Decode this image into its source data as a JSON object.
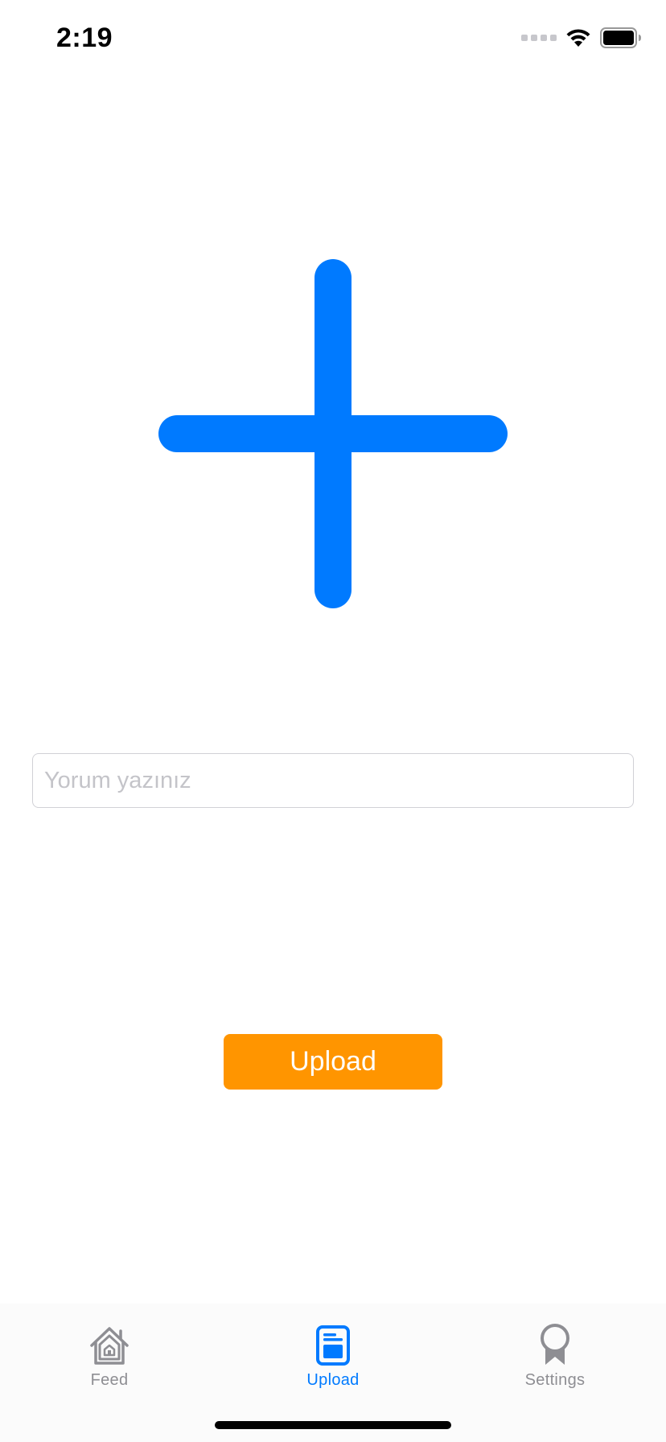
{
  "status_bar": {
    "time": "2:19"
  },
  "main": {
    "image_icon": "plus-icon",
    "comment_placeholder": "Yorum yazınız",
    "comment_value": "",
    "upload_label": "Upload"
  },
  "tab_bar": {
    "items": [
      {
        "label": "Feed",
        "icon": "home-icon",
        "active": false
      },
      {
        "label": "Upload",
        "icon": "upload-icon",
        "active": true
      },
      {
        "label": "Settings",
        "icon": "settings-icon",
        "active": false
      }
    ]
  },
  "colors": {
    "accent": "#007AFF",
    "button": "#FF9500",
    "inactive": "#8E8E93"
  }
}
